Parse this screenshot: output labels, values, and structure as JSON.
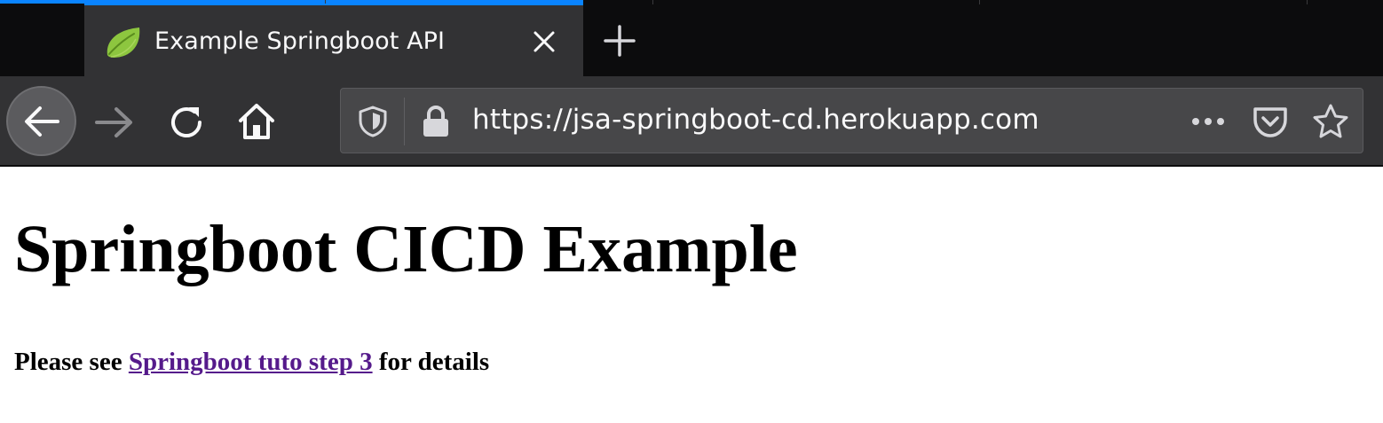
{
  "tab": {
    "title": "Example Springboot API"
  },
  "urlbar": {
    "url": "https://jsa-springboot-cd.herokuapp.com"
  },
  "page": {
    "heading": "Springboot CICD Example",
    "paragraph_before": "Please see ",
    "link_text": "Springboot tuto step 3",
    "paragraph_after": " for details"
  },
  "icons": {
    "favicon": "spring-leaf-icon",
    "close": "close-icon",
    "new_tab": "plus-icon",
    "back": "arrow-left-icon",
    "forward": "arrow-right-icon",
    "reload": "reload-icon",
    "home": "home-icon",
    "tracking": "shield-icon",
    "lock": "lock-icon",
    "more": "more-dots-icon",
    "pocket": "pocket-icon",
    "bookmark": "star-icon"
  },
  "colors": {
    "tab_strip_bg": "#0c0c0d",
    "toolbar_bg": "#323234",
    "urlbar_bg": "#474749",
    "accent": "#0a84ff",
    "link_visited": "#551a8b",
    "favicon_green": "#8dc63f"
  }
}
